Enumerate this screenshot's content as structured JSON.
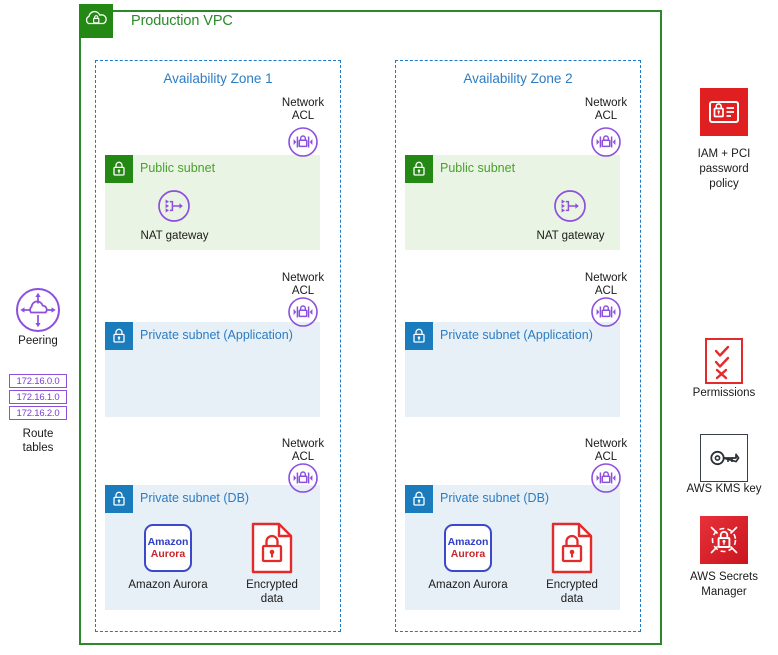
{
  "vpc": {
    "title": "Production VPC",
    "icon": "vpc-cloud-lock-icon",
    "border_color": "#2a8a2a"
  },
  "availability_zones": [
    {
      "title": "Availability Zone 1",
      "subnets": [
        {
          "type": "public",
          "label": "Public subnet",
          "icon": "subnet-lock-icon",
          "nacl": {
            "line1": "Network",
            "line2": "ACL",
            "icon": "network-acl-icon"
          },
          "nodes": [
            {
              "label": "NAT gateway",
              "icon": "nat-gateway-icon"
            }
          ]
        },
        {
          "type": "private",
          "label": "Private subnet (Application)",
          "icon": "subnet-lock-icon",
          "nacl": {
            "line1": "Network",
            "line2": "ACL",
            "icon": "network-acl-icon"
          },
          "nodes": []
        },
        {
          "type": "private",
          "label": "Private subnet (DB)",
          "icon": "subnet-lock-icon",
          "nacl": {
            "line1": "Network",
            "line2": "ACL",
            "icon": "network-acl-icon"
          },
          "nodes": [
            {
              "label": "Amazon Aurora",
              "icon": "amazon-aurora-icon",
              "badge_top": "Amazon",
              "badge_bottom": "Aurora"
            },
            {
              "label_line1": "Encrypted",
              "label_line2": "data",
              "icon": "encrypted-data-icon"
            }
          ]
        }
      ]
    },
    {
      "title": "Availability Zone 2",
      "subnets": [
        {
          "type": "public",
          "label": "Public subnet",
          "icon": "subnet-lock-icon",
          "nacl": {
            "line1": "Network",
            "line2": "ACL",
            "icon": "network-acl-icon"
          },
          "nodes": [
            {
              "label": "NAT gateway",
              "icon": "nat-gateway-icon"
            }
          ]
        },
        {
          "type": "private",
          "label": "Private subnet (Application)",
          "icon": "subnet-lock-icon",
          "nacl": {
            "line1": "Network",
            "line2": "ACL",
            "icon": "network-acl-icon"
          },
          "nodes": []
        },
        {
          "type": "private",
          "label": "Private subnet (DB)",
          "icon": "subnet-lock-icon",
          "nacl": {
            "line1": "Network",
            "line2": "ACL",
            "icon": "network-acl-icon"
          },
          "nodes": [
            {
              "label": "Amazon Aurora",
              "icon": "amazon-aurora-icon",
              "badge_top": "Amazon",
              "badge_bottom": "Aurora"
            },
            {
              "label_line1": "Encrypted",
              "label_line2": "data",
              "icon": "encrypted-data-icon"
            }
          ]
        }
      ]
    }
  ],
  "left_column": {
    "peering": {
      "label": "Peering",
      "icon": "vpc-peering-icon"
    },
    "route_tables": {
      "label_line1": "Route",
      "label_line2": "tables",
      "entries": [
        "172.16.0.0",
        "172.16.1.0",
        "172.16.2.0"
      ]
    }
  },
  "right_sidebar": [
    {
      "icon": "iam-pci-password-policy-icon",
      "label_line1": "IAM + PCI",
      "label_line2": "password",
      "label_line3": "policy"
    },
    {
      "icon": "permissions-icon",
      "label_line1": "Permissions"
    },
    {
      "icon": "aws-kms-key-icon",
      "label_line1": "AWS KMS key"
    },
    {
      "icon": "aws-secrets-manager-icon",
      "label_line1": "AWS Secrets",
      "label_line2": "Manager"
    }
  ],
  "colors": {
    "vpc_green": "#2a8a2a",
    "subnet_green_tile": "#248814",
    "subnet_blue_tile": "#1a7bbd",
    "az_blue": "#2b7cc4",
    "purple": "#8c4fde",
    "red": "#e02020",
    "public_fill": "#eaf4e4",
    "private_fill": "#e7f0f7"
  }
}
